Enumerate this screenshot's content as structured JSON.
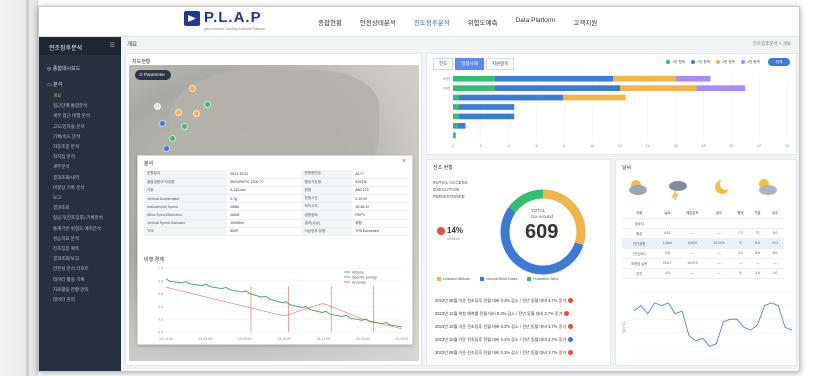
{
  "app": {
    "logo_text": "P.L.A.P",
    "logo_sub": "pilot oriented Landing Analysis Platform"
  },
  "nav": [
    "종합현황",
    "안전상태분석",
    "진도정후분석",
    "위험도예측",
    "Data Platform",
    "고객지원"
  ],
  "nav_active_index": 2,
  "sidebar": {
    "title": "전조징후분석",
    "groups": [
      {
        "label": "종합대시보드"
      },
      {
        "label": "분석"
      }
    ],
    "items": [
      "개요",
      "접근단계 통합분석",
      "세부 접근 비행 분석",
      "고도/강하율 분석",
      "기체/속도 분석",
      "자동조종 분석",
      "착지점 분석",
      "세부분석",
      "결과조회/내역",
      "비정상 기록 분석",
      "보고",
      "결과조회",
      "항공기(전조징후) 기록분석",
      "통계기반 위험도 예측분석",
      "성능지표 분석",
      "전조징후 예측",
      "결과조회/보고",
      "안전성 분석 리포트",
      "데이터 활용 기록",
      "자료활용 현황 관리",
      "데이터 관리"
    ],
    "active_index": 0
  },
  "breadcrumb": "개요",
  "crumb_right": "전조징후분석 > 개요",
  "map_card": {
    "title": "지도현황",
    "param_button": "Parameter"
  },
  "popup": {
    "title": "분석",
    "close": "×",
    "rows": [
      [
        "운항일자",
        "2021.10.01",
        "운항편번호",
        "A1??"
      ],
      [
        "출발공항/도착공항",
        "RKSI/RKPC 1300 ??",
        "항공기유형",
        "A321N"
      ],
      [
        "기종",
        "A-321neo",
        "편명",
        "ABC123"
      ],
      [
        "Vertical Acceleration",
        "0.7g",
        "운항시간",
        "2:10:00"
      ],
      [
        "Indicated Air Speed",
        "265kt",
        "착지시각",
        "10:48:42"
      ],
      [
        "Wind Speed/Direction",
        "260/8",
        "공항정보",
        "RKPC"
      ],
      [
        "Vertical Speed Indicator",
        "1000ft/m",
        "결과(사유)",
        "위험"
      ],
      [
        "TPA",
        "500F",
        "이상징후 유형",
        "TPA Exceeded"
      ]
    ],
    "trend_title": "비행 경계",
    "trend_legend": [
      "Altitude",
      "Specific Energy",
      "Anomaly"
    ],
    "trend_xticks": [
      "14:13:00",
      "14:14:00",
      "14:15:00",
      "14:16:00",
      "14:17:00",
      "14:18:00",
      "14:19:00"
    ],
    "trend_yticks": [
      "1.0",
      "0.8",
      "0.6",
      "0.4",
      "0.2",
      "0.0"
    ]
  },
  "bar_card": {
    "tabs": [
      "전도",
      "발생사례",
      "지원항목"
    ],
    "active_tab": 1,
    "legend": [
      "■ 1번 항목",
      "■ 2번 항목",
      "■ 3번 항목",
      "■ 4번 항목"
    ],
    "toggle": "전체",
    "yticks": [
      "25번",
      "24번"
    ],
    "xticks": [
      "0",
      "2",
      "4",
      "6",
      "8",
      "10",
      "12",
      "14",
      "16",
      "18",
      "20",
      "22",
      "24"
    ]
  },
  "donut_card": {
    "title": "전조 현황",
    "labels": [
      "INITIAL ACCESS",
      "EXECUTION",
      "PERSISTENCE"
    ],
    "percent": "14%",
    "percent_sub": "Network",
    "total_label": "TOTAL",
    "total_sub": "Go-Around",
    "total": "609",
    "legend": [
      "Unstable Attitude",
      "Normal Wind Gusts",
      "Floatation Wind"
    ],
    "notices": [
      "2023년 08월 기준 전조징후 전월 대비 0.2% 감소 / 전년 동월 대비 3.7% 증가",
      "2023년 12월 위험 예측률 전월 대비 0.2% 감소 / 전년 동월 대비 3.7% 증가",
      "2023년 10월 기준 전조징후 전월 대비 0.2% 감소 / 전년 동월 대비 3.7% 증가",
      "2023년 10월 기준 전조징후 전월 대비 0.2% 감소 / 전년 동월 대비 3.7% 증가",
      "2023년 08월 기준 전조징후 전월 대비 0.2% 감소 / 전년 동월 대비 3.7% 증가"
    ]
  },
  "weather_card": {
    "title": "날씨",
    "headers": [
      "지점",
      "날씨",
      "체감온도",
      "습도",
      "풍속",
      "기압",
      "강수"
    ],
    "rows": [
      [
        "경상지",
        "",
        "",
        "",
        "",
        "",
        ""
      ],
      [
        "월성",
        "A1S",
        "—",
        "—",
        "7.2",
        "72",
        "5.0"
      ],
      [
        "인천공항",
        "1.01m",
        "10000",
        "10.21%",
        "9",
        "9.6",
        "+0.2"
      ],
      [
        "인천(SE)",
        "4.5",
        "—",
        "—",
        "3.0",
        "8.8",
        "8.0"
      ],
      [
        "조종장 실측",
        "HOLT",
        "1019.9",
        "—",
        "—",
        "—",
        "—"
      ],
      [
        "인천",
        "4.5",
        "—",
        "—",
        "8",
        "3.6",
        "4.0"
      ]
    ],
    "axis_label": "기온(℃)"
  },
  "chart_data": [
    {
      "type": "bar",
      "title": "",
      "categories": [
        "25번",
        "24번",
        "23번",
        "22번",
        "21번",
        "20번",
        "19번"
      ],
      "series": [
        {
          "name": "1번 항목",
          "values": [
            3,
            3,
            0.4,
            0.4,
            0.4,
            0.3,
            0.2
          ]
        },
        {
          "name": "2번 항목",
          "values": [
            8.5,
            9,
            7.5,
            4,
            4,
            0.6,
            0
          ]
        },
        {
          "name": "3번 항목",
          "values": [
            4.5,
            5.5,
            4.5,
            0,
            0,
            0,
            0
          ]
        },
        {
          "name": "4번 항목",
          "values": [
            2.5,
            3.5,
            0,
            0,
            0,
            0,
            0
          ]
        }
      ],
      "xlim": [
        0,
        24
      ]
    },
    {
      "type": "pie",
      "title": "",
      "labels": [
        "Unstable Attitude",
        "Normal Wind Gusts",
        "Floatation Wind"
      ],
      "values": [
        30,
        55,
        15
      ],
      "total": 609
    },
    {
      "type": "line",
      "title": "",
      "x": [
        0,
        1,
        2,
        3,
        4,
        5,
        6,
        7,
        8,
        9,
        10,
        11,
        12,
        13,
        14,
        15,
        16,
        17,
        18,
        19,
        20,
        21,
        22,
        23
      ],
      "series": [
        {
          "name": "",
          "values": [
            18,
            20,
            17,
            21,
            20,
            21,
            17,
            18,
            9,
            7,
            8,
            5,
            6,
            14,
            15,
            15,
            12,
            11,
            13,
            20,
            21,
            20,
            12,
            11
          ]
        }
      ],
      "ylabel": "기온(℃)"
    },
    {
      "type": "line",
      "title": "",
      "x": [
        "14:13:00",
        "14:14:00",
        "14:15:00",
        "14:16:00",
        "14:17:00",
        "14:18:00",
        "14:19:00"
      ],
      "series": [
        {
          "name": "Altitude",
          "values": [
            0.8,
            0.72,
            0.62,
            0.45,
            0.3,
            0.18,
            0.08
          ]
        },
        {
          "name": "Specific Energy",
          "values": [
            0.7,
            0.55,
            0.4,
            0.25,
            0.45,
            0.2,
            0.05
          ]
        }
      ],
      "ylim": [
        0,
        1
      ]
    }
  ]
}
